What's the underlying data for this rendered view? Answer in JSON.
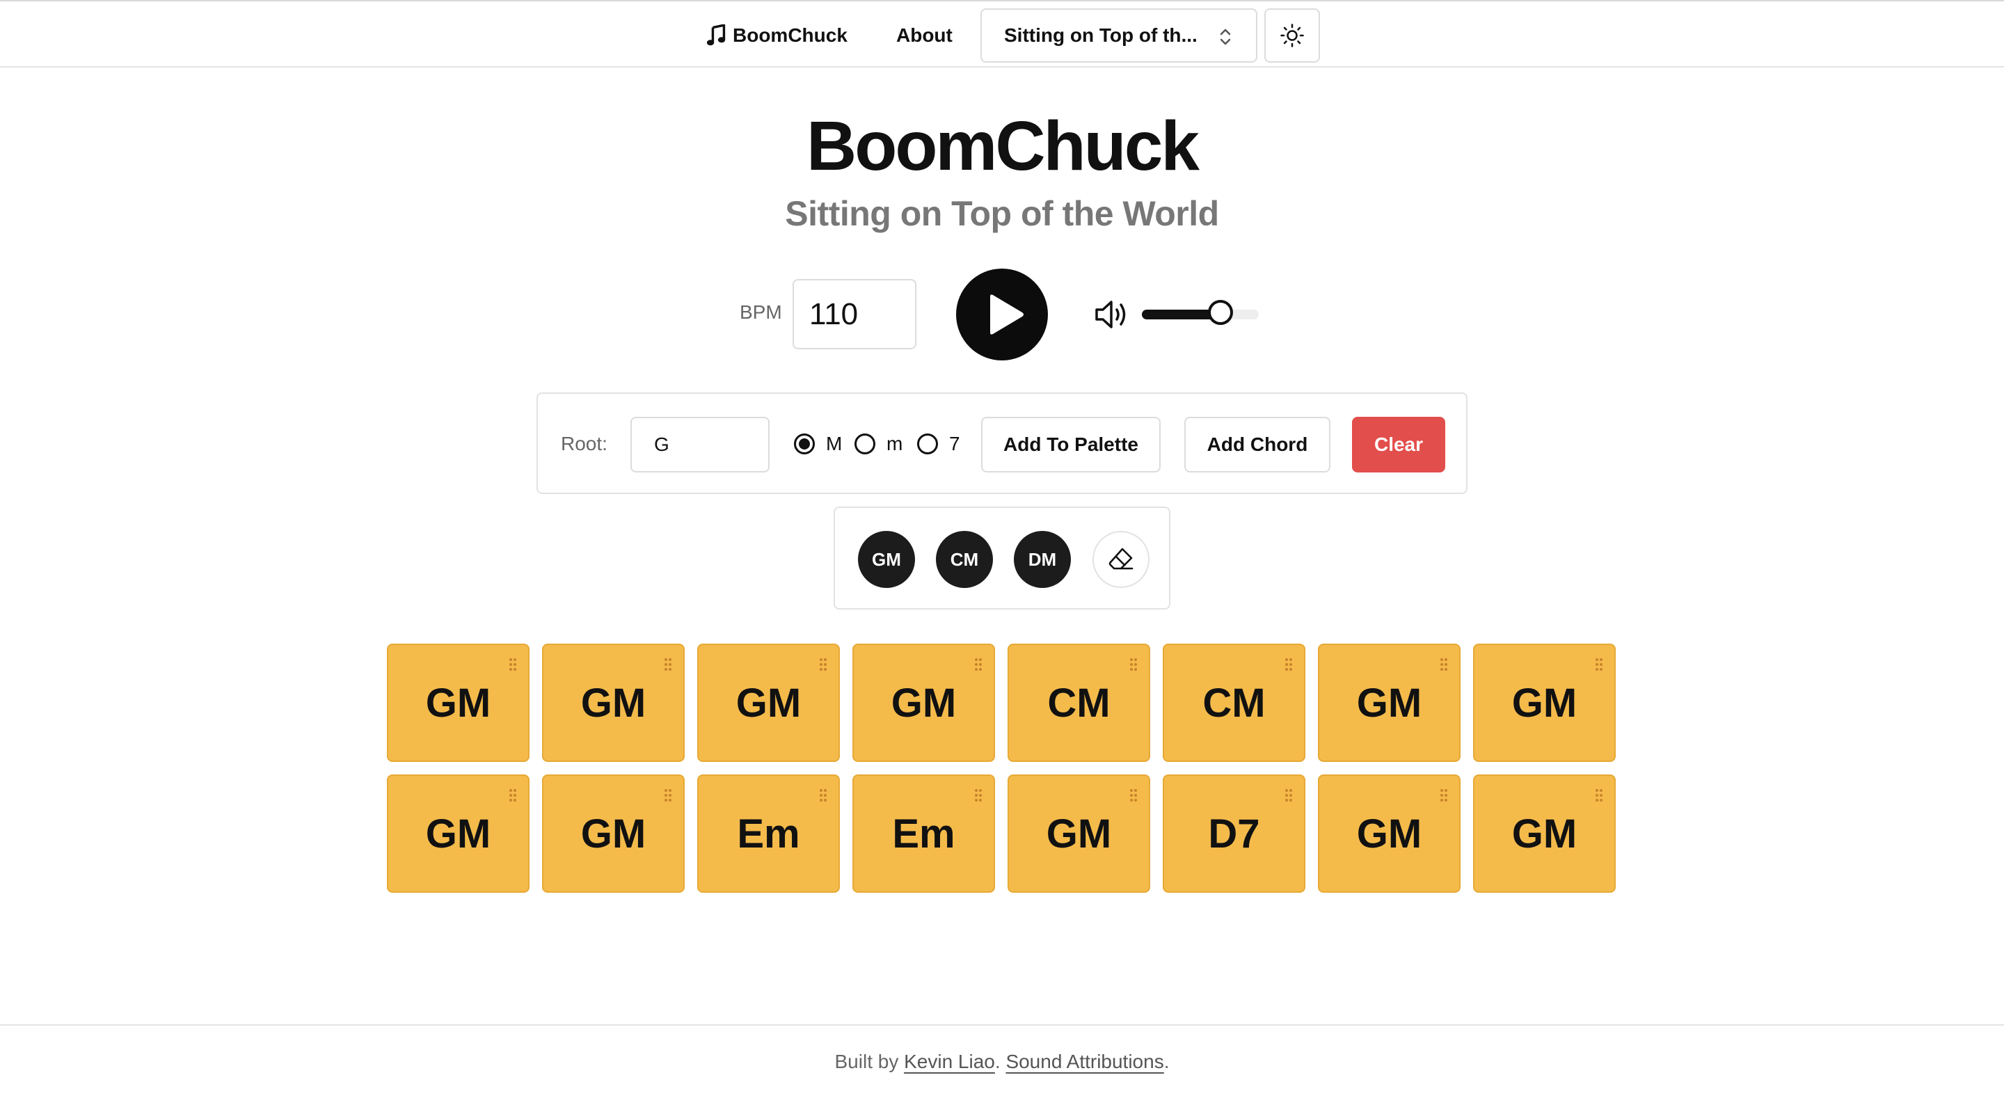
{
  "nav": {
    "brand": "BoomChuck",
    "about": "About",
    "song_select": "Sitting on Top of th...",
    "theme_icon": "sun-icon"
  },
  "header": {
    "title": "BoomChuck",
    "subtitle": "Sitting on Top of the World"
  },
  "transport": {
    "bpm_label": "BPM",
    "bpm_value": "110",
    "volume_level": 0.67
  },
  "builder": {
    "root_label": "Root:",
    "root_value": "G",
    "qualities": [
      {
        "label": "M",
        "selected": true
      },
      {
        "label": "m",
        "selected": false
      },
      {
        "label": "7",
        "selected": false
      }
    ],
    "add_to_palette": "Add To Palette",
    "add_chord": "Add Chord",
    "clear": "Clear"
  },
  "palette": {
    "chords": [
      "GM",
      "CM",
      "DM"
    ],
    "eraser_icon": "eraser-icon"
  },
  "progression": {
    "rows": [
      [
        "GM",
        "GM",
        "GM",
        "GM",
        "CM",
        "CM",
        "GM",
        "GM"
      ],
      [
        "GM",
        "GM",
        "Em",
        "Em",
        "GM",
        "D7",
        "GM",
        "GM"
      ]
    ]
  },
  "footer": {
    "prefix": "Built by ",
    "author": "Kevin Liao",
    "sep": ". ",
    "attributions": "Sound Attributions",
    "suffix": "."
  },
  "colors": {
    "accent": "#f4bb4b",
    "clear": "#e24e4b",
    "dark": "#0c0c0c"
  }
}
